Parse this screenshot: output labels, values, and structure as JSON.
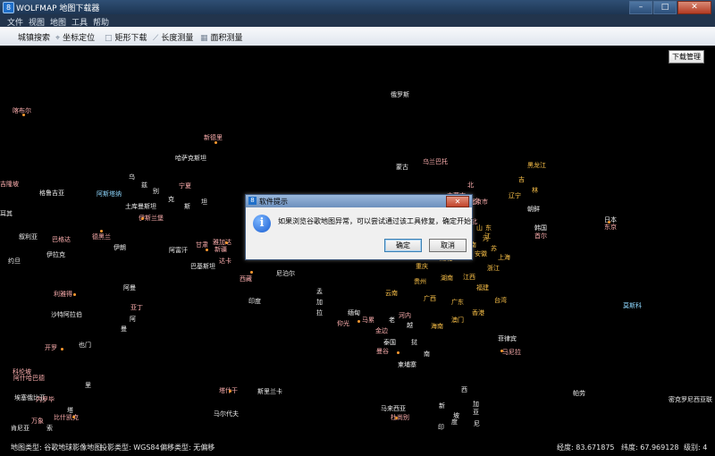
{
  "window": {
    "title": "WOLFMAP 地图下载器",
    "app_icon": "8"
  },
  "menu": [
    "文件",
    "视图",
    "地图",
    "工具",
    "帮助"
  ],
  "toolbar": [
    "城镇搜索",
    "坐标定位",
    "矩形下载",
    "长度测量",
    "面积测量"
  ],
  "download_manager": "下载管理",
  "map_labels": [
    "俄罗斯",
    "哈萨克斯坦",
    "蒙古",
    "乌",
    "兹",
    "别",
    "克",
    "土库曼斯坦",
    "斯",
    "坦",
    "阿富汗",
    "巴基斯坦",
    "尼泊尔",
    "印度",
    "孟",
    "加",
    "拉",
    "缅甸",
    "泰国",
    "老",
    "挝",
    "越",
    "柬埔寨",
    "南",
    "马来西亚",
    "菲律宾",
    "日本",
    "韩国",
    "朝鲜",
    "伊朗",
    "伊拉克",
    "约旦",
    "格鲁吉亚",
    "叙利亚",
    "沙特阿拉伯",
    "阿曼",
    "也门",
    "阿",
    "曼",
    "埃塞俄比亚",
    "里",
    "斯里兰卡",
    "马尔代夫",
    "新",
    "加",
    "坡",
    "印",
    "度",
    "尼",
    "西",
    "亚",
    "肯尼亚",
    "索",
    "帕劳",
    "密克罗尼西亚联",
    "耳其",
    "塔"
  ],
  "highlight_labels": [
    "黑龙江",
    "吉",
    "林",
    "辽宁",
    "北",
    "京",
    "山",
    "东",
    "河",
    "南",
    "江",
    "苏",
    "安徽",
    "上海",
    "浙江",
    "湖北",
    "重庆",
    "贵州",
    "湖南",
    "江西",
    "福建",
    "台湾",
    "云南",
    "广西",
    "广东",
    "澳门",
    "香港",
    "海南",
    "四川",
    "乌兰巴托",
    "内蒙古",
    "青海",
    "西藏",
    "新疆",
    "甘肃",
    "宁夏",
    "陕西",
    "山西",
    "河北",
    "天津",
    "北京市",
    "东京",
    "首尔",
    "河内",
    "曼谷",
    "仰光",
    "马尼拉",
    "新德里",
    "伊斯兰堡",
    "德黑兰",
    "巴格达",
    "利雅得",
    "开罗",
    "喀布尔",
    "阿什哈巴德",
    "塔什干",
    "比什凯克",
    "杜尚别",
    "阿斯塔纳",
    "莫斯科",
    "亚丁",
    "吉隆坡",
    "雅加达",
    "达卡",
    "科伦坡",
    "马累",
    "金边",
    "万象",
    "内罗毕",
    "喀土穆"
  ],
  "status": {
    "map_type": "地图类型: 谷歌地球影像地图",
    "projection": "投影类型: WGS84",
    "offset": "偏移类型: 无偏移",
    "lng": "经度: 83.671875",
    "lat": "纬度: 67.969128",
    "level": "级别: 4"
  },
  "dialog": {
    "title": "软件提示",
    "message": "如果浏览谷歌地图异常，可以尝试通过该工具修复，确定开始？",
    "ok": "确定",
    "cancel": "取消",
    "icon": "info-icon"
  }
}
